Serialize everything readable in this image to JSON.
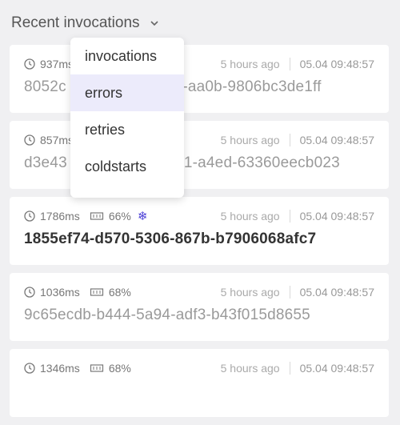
{
  "header": {
    "title": "Recent invocations"
  },
  "dropdown": {
    "options": [
      "invocations",
      "errors",
      "retries",
      "coldstarts"
    ],
    "highlighted_index": 1
  },
  "invocations": [
    {
      "duration": "937ms",
      "memory": "",
      "time_ago": "5 hours ago",
      "timestamp": "05.04 09:48:57",
      "id": "8052c",
      "id_tail": "8b-aa0b-9806bc3de1ff",
      "cold_start": false
    },
    {
      "duration": "857ms",
      "memory": "",
      "time_ago": "5 hours ago",
      "timestamp": "05.04 09:48:57",
      "id": "d3e43",
      "id_tail": "1-a4ed-63360eecb023",
      "cold_start": false
    },
    {
      "duration": "1786ms",
      "memory": "66%",
      "time_ago": "5 hours ago",
      "timestamp": "05.04 09:48:57",
      "id": "1855ef74-d570-5306-867b-b7906068afc7",
      "cold_start": true
    },
    {
      "duration": "1036ms",
      "memory": "68%",
      "time_ago": "5 hours ago",
      "timestamp": "05.04 09:48:57",
      "id": "9c65ecdb-b444-5a94-adf3-b43f015d8655",
      "cold_start": false
    },
    {
      "duration": "1346ms",
      "memory": "68%",
      "time_ago": "5 hours ago",
      "timestamp": "05.04 09:48:57",
      "id": "",
      "cold_start": false
    }
  ],
  "icons": {
    "duration": "clock-icon",
    "memory": "memory-chip-icon",
    "cold_start": "snowflake-icon",
    "dropdown": "chevron-down-icon"
  },
  "colors": {
    "accent": "#4b3fd6",
    "highlight": "#ecebfb"
  }
}
